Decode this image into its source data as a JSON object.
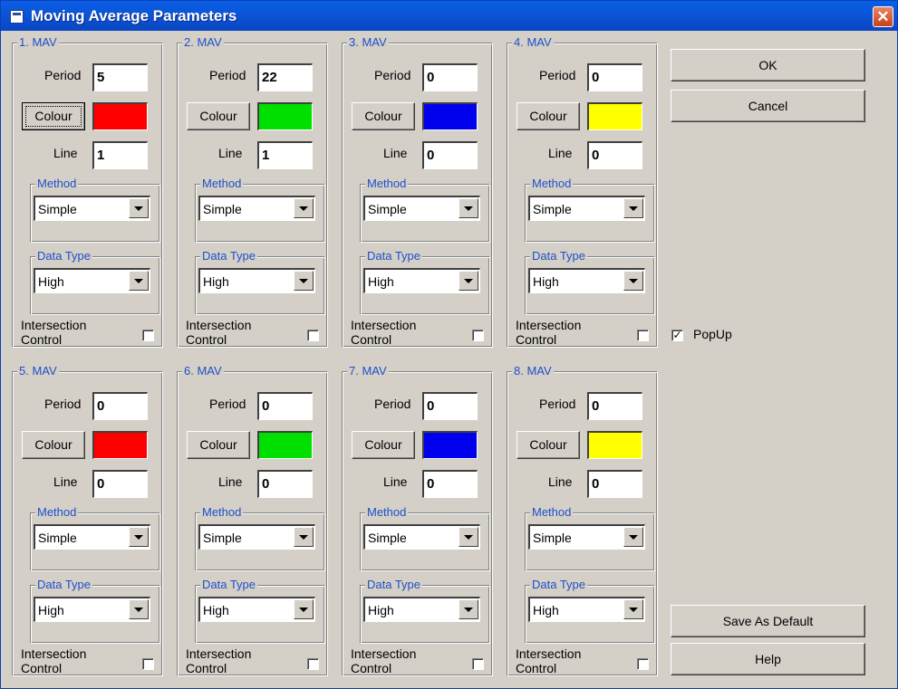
{
  "window": {
    "title": "Moving Average Parameters",
    "close_glyph": "✕"
  },
  "labels": {
    "period": "Period",
    "colour": "Colour",
    "line": "Line",
    "method": "Method",
    "data_type": "Data Type",
    "intersection_1": "Intersection",
    "intersection_2": "Control"
  },
  "mavs": [
    {
      "title": "1. MAV",
      "period": "5",
      "line": "1",
      "color": "#ff0000",
      "method": "Simple",
      "data_type": "High",
      "intersection": false
    },
    {
      "title": "2. MAV",
      "period": "22",
      "line": "1",
      "color": "#00e000",
      "method": "Simple",
      "data_type": "High",
      "intersection": false
    },
    {
      "title": "3. MAV",
      "period": "0",
      "line": "0",
      "color": "#0000ee",
      "method": "Simple",
      "data_type": "High",
      "intersection": false
    },
    {
      "title": "4. MAV",
      "period": "0",
      "line": "0",
      "color": "#ffff00",
      "method": "Simple",
      "data_type": "High",
      "intersection": false
    },
    {
      "title": "5. MAV",
      "period": "0",
      "line": "0",
      "color": "#ff0000",
      "method": "Simple",
      "data_type": "High",
      "intersection": false
    },
    {
      "title": "6. MAV",
      "period": "0",
      "line": "0",
      "color": "#00e000",
      "method": "Simple",
      "data_type": "High",
      "intersection": false
    },
    {
      "title": "7. MAV",
      "period": "0",
      "line": "0",
      "color": "#0000ee",
      "method": "Simple",
      "data_type": "High",
      "intersection": false
    },
    {
      "title": "8. MAV",
      "period": "0",
      "line": "0",
      "color": "#ffff00",
      "method": "Simple",
      "data_type": "High",
      "intersection": false
    }
  ],
  "buttons": {
    "ok": "OK",
    "cancel": "Cancel",
    "save_default": "Save As Default",
    "help": "Help"
  },
  "popup": {
    "label": "PopUp",
    "checked": true,
    "check_glyph": "✓"
  }
}
